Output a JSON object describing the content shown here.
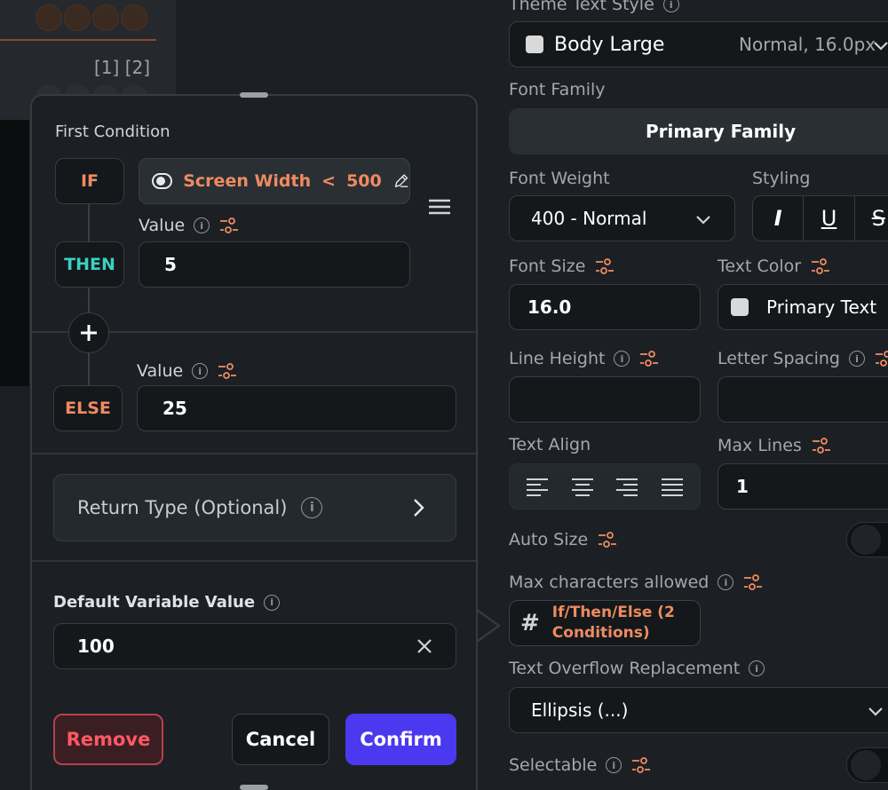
{
  "background": {
    "pager": "[1] [2]"
  },
  "right_panel": {
    "theme_text_style": {
      "label": "Theme Text Style",
      "value": "Body Large",
      "detail": "Normal, 16.0px"
    },
    "font_family": {
      "label": "Font Family",
      "value": "Primary Family"
    },
    "font_weight": {
      "label": "Font Weight",
      "value": "400 - Normal"
    },
    "styling": {
      "label": "Styling",
      "italic": "I",
      "underline": "U",
      "strike": "S"
    },
    "font_size": {
      "label": "Font Size",
      "value": "16.0"
    },
    "text_color": {
      "label": "Text Color",
      "value": "Primary Text"
    },
    "line_height": {
      "label": "Line Height",
      "value": ""
    },
    "letter_spacing": {
      "label": "Letter Spacing",
      "value": ""
    },
    "text_align": {
      "label": "Text Align"
    },
    "max_lines": {
      "label": "Max Lines",
      "value": "1"
    },
    "auto_size": {
      "label": "Auto Size"
    },
    "max_characters": {
      "label": "Max characters allowed",
      "value_line1": "If/Then/Else (2",
      "value_line2": "Conditions)"
    },
    "text_overflow": {
      "label": "Text Overflow Replacement",
      "value": "Ellipsis (...)"
    },
    "selectable": {
      "label": "Selectable"
    }
  },
  "dialog": {
    "first_condition_label": "First Condition",
    "if_label": "IF",
    "condition": {
      "variable": "Screen Width",
      "operator": "<",
      "value": "500"
    },
    "then_label": "THEN",
    "then_value_label": "Value",
    "then_value": "5",
    "else_label": "ELSE",
    "else_value_label": "Value",
    "else_value": "25",
    "return_type_label": "Return Type (Optional)",
    "default_label": "Default Variable Value",
    "default_value": "100",
    "remove_label": "Remove",
    "cancel_label": "Cancel",
    "confirm_label": "Confirm"
  },
  "colors": {
    "accent_orange": "#ee8b60",
    "accent_teal": "#39d2c0",
    "confirm_purple": "#4b39ef",
    "remove_red": "#ff5963"
  }
}
